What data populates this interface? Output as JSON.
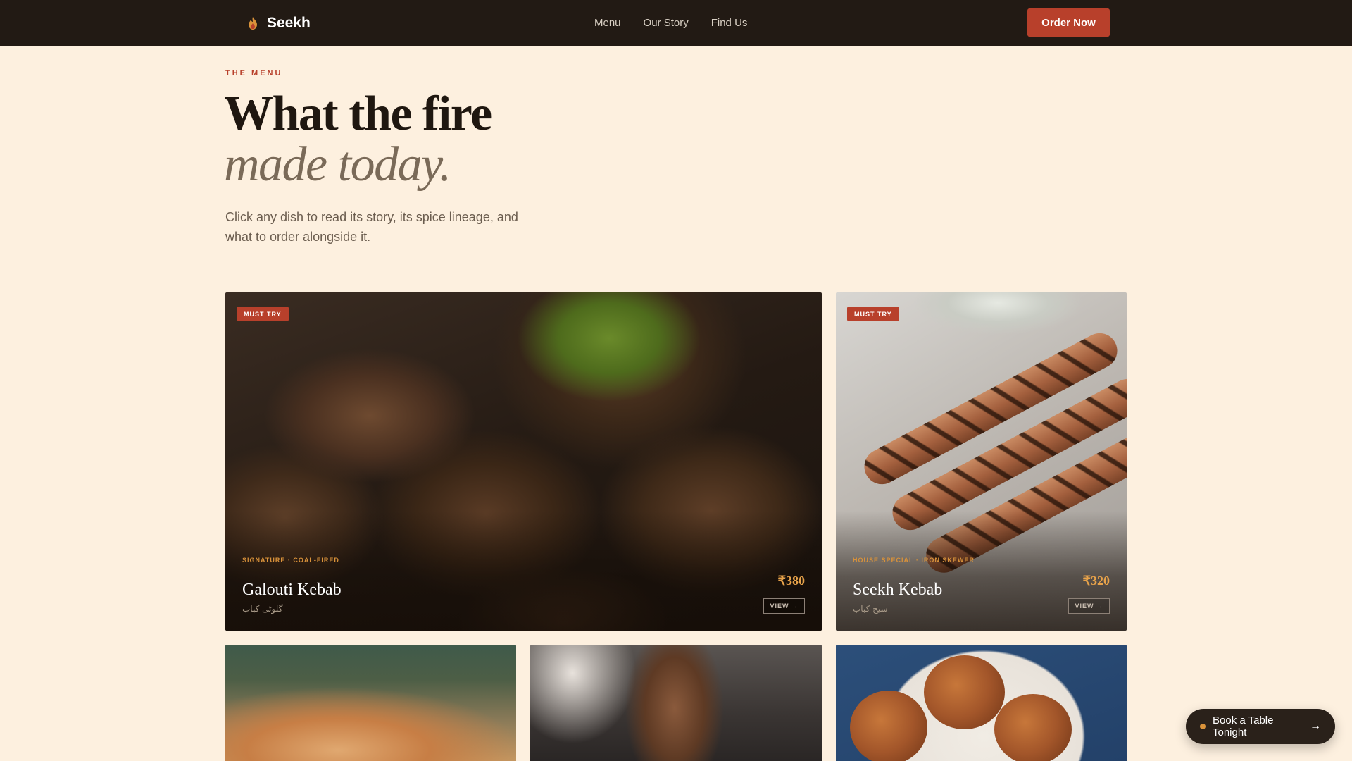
{
  "nav": {
    "brand": "Seekh",
    "links": [
      "Menu",
      "Our Story",
      "Find Us"
    ],
    "order_button": "Order Now"
  },
  "hero": {
    "eyebrow": "THE MENU",
    "title_line1": "What the fire",
    "title_line2": "made today.",
    "intro": "Click any dish to read its story, its spice lineage, and what to order alongside it."
  },
  "featured": [
    {
      "badge": "MUST TRY",
      "tags": "SIGNATURE · COAL-FIRED",
      "name": "Galouti Kebab",
      "native_name": "گلوٹی کباب",
      "price": "₹380",
      "view": "VIEW →"
    },
    {
      "badge": "MUST TRY",
      "tags": "HOUSE SPECIAL · IRON SKEWER",
      "name": "Seekh Kebab",
      "native_name": "سیخ کباب",
      "price": "₹320",
      "view": "VIEW →"
    }
  ],
  "booking": {
    "label": "Book a Table Tonight",
    "arrow": "→"
  },
  "icons": {
    "brand": "flame-icon",
    "arrow": "arrow-right-icon"
  },
  "colors": {
    "accent": "#b8402b",
    "price": "#e8a34a",
    "nav_bg": "#221a14",
    "page_bg": "#fdf0df"
  }
}
